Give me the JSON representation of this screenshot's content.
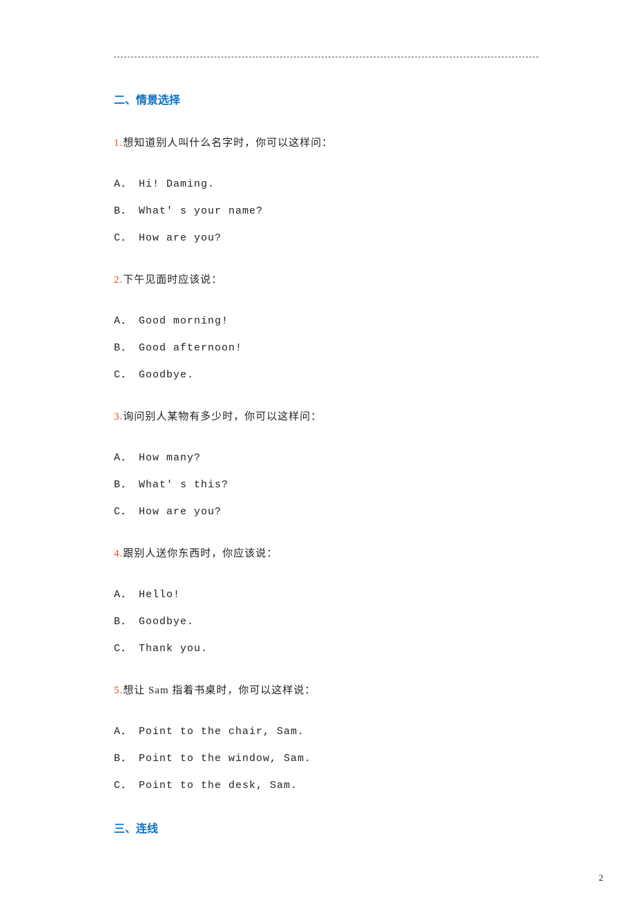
{
  "section2_heading": "二、情景选择",
  "questions": [
    {
      "num": "1.",
      "prompt": "想知道别人叫什么名字时，你可以这样问：",
      "choices": [
        "A． Hi! Daming.",
        "B． What' s your name?",
        "C． How are you?"
      ]
    },
    {
      "num": "2.",
      "prompt": "下午见面时应该说：",
      "choices": [
        "A． Good morning!",
        "B． Good afternoon!",
        "C． Goodbye."
      ]
    },
    {
      "num": "3.",
      "prompt": "询问别人某物有多少时，你可以这样问：",
      "choices": [
        "A． How many?",
        "B． What' s this?",
        "C． How are you?"
      ]
    },
    {
      "num": "4.",
      "prompt": "跟别人送你东西时，你应该说：",
      "choices": [
        "A． Hello!",
        "B． Goodbye.",
        "C． Thank you."
      ]
    },
    {
      "num": "5.",
      "prompt": "想让 Sam 指着书桌时，你可以这样说：",
      "choices": [
        "A． Point to the chair, Sam.",
        "B． Point to the window, Sam.",
        "C． Point to the desk, Sam."
      ]
    }
  ],
  "section3_heading": "三、连线",
  "page_number": "2"
}
